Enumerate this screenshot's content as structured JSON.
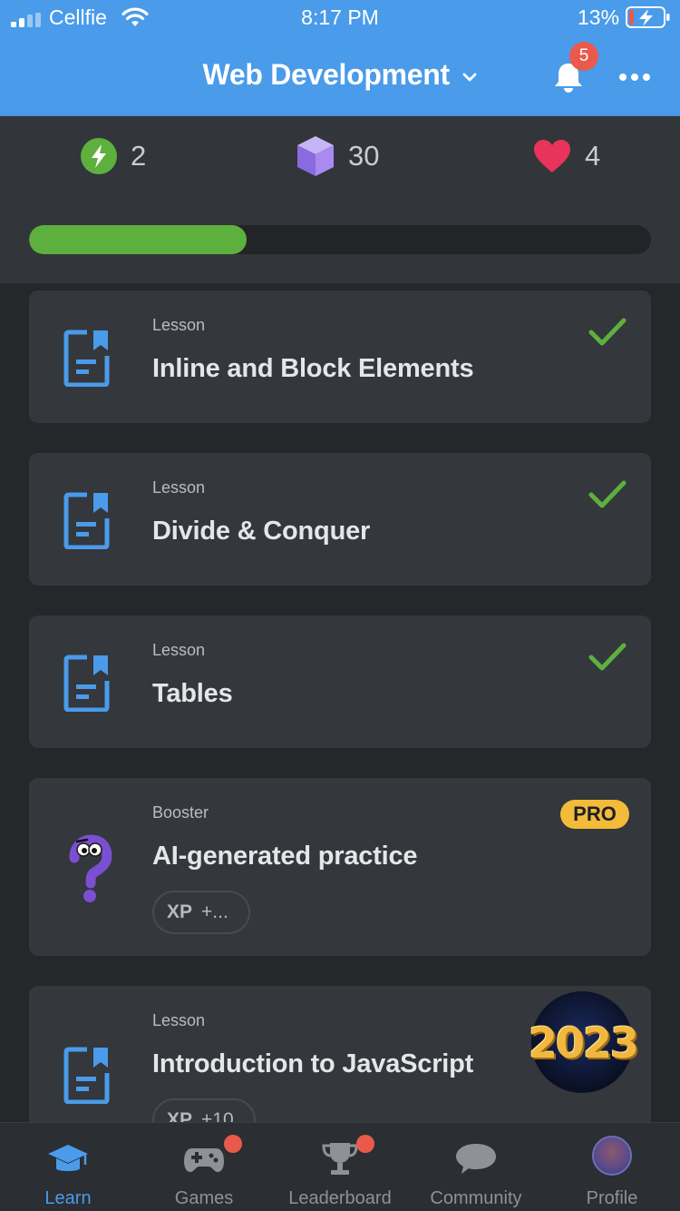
{
  "status_bar": {
    "carrier": "Cellfie",
    "time": "8:17 PM",
    "battery_percent": "13%"
  },
  "header": {
    "title": "Web Development",
    "notifications_count": "5"
  },
  "stats": {
    "energy": "2",
    "gems": "30",
    "hearts": "4"
  },
  "progress": {
    "fraction": 0.35
  },
  "cards": [
    {
      "type": "Lesson",
      "title": "Inline and Block Elements",
      "icon": "lesson-doc-icon",
      "completed": true
    },
    {
      "type": "Lesson",
      "title": "Divide & Conquer",
      "icon": "lesson-doc-icon",
      "completed": true
    },
    {
      "type": "Lesson",
      "title": "Tables",
      "icon": "lesson-doc-icon",
      "completed": true
    },
    {
      "type": "Booster",
      "title": "AI-generated practice",
      "icon": "question-mascot-icon",
      "badge": "PRO",
      "xp_label": "XP",
      "xp_value": "+..."
    },
    {
      "type": "Lesson",
      "title": "Introduction to JavaScript",
      "icon": "lesson-doc-icon",
      "xp_label": "XP",
      "xp_value": "+10",
      "corner_badge": "2023"
    }
  ],
  "tabs": [
    {
      "label": "Learn",
      "icon": "graduation-cap-icon",
      "active": true
    },
    {
      "label": "Games",
      "icon": "gamepad-icon",
      "dot": true
    },
    {
      "label": "Leaderboard",
      "icon": "trophy-icon",
      "dot": true
    },
    {
      "label": "Community",
      "icon": "chat-bubble-icon"
    },
    {
      "label": "Profile",
      "icon": "avatar"
    }
  ],
  "colors": {
    "header_blue": "#4a9bea",
    "progress_green": "#5eb03e",
    "check_green": "#5eb03e",
    "heart_red": "#e8335a",
    "gem_purple": "#9b7be8",
    "pro_yellow": "#f2bb3a",
    "badge_red": "#e95a4c"
  }
}
